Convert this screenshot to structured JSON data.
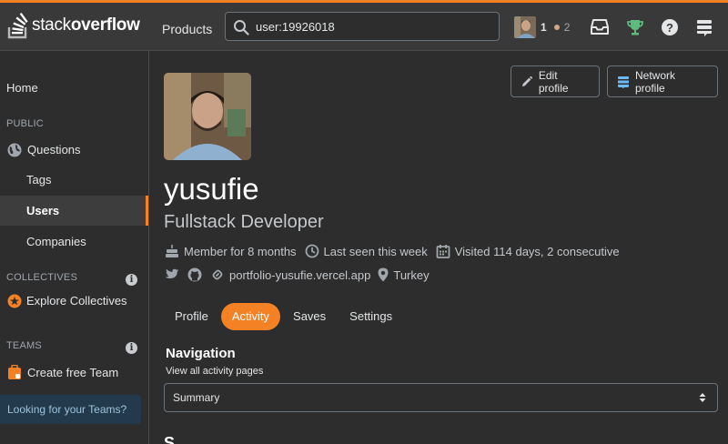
{
  "topbar": {
    "logo_light": "stack",
    "logo_bold": "overflow",
    "products_label": "Products",
    "search_value": "user:19926018",
    "reputation": "1",
    "bronze_badges": "2",
    "accent_color": "#f48225"
  },
  "sidebar": {
    "home": "Home",
    "public_heading": "PUBLIC",
    "questions": "Questions",
    "tags": "Tags",
    "users": "Users",
    "companies": "Companies",
    "collectives_heading": "COLLECTIVES",
    "explore_collectives": "Explore Collectives",
    "teams_heading": "TEAMS",
    "create_team": "Create free Team",
    "teams_callout": "Looking for your Teams?"
  },
  "profile": {
    "edit_button": "Edit profile",
    "network_button": "Network profile",
    "name": "yusufie",
    "title": "Fullstack Developer",
    "member_for": "Member for 8 months",
    "last_seen": "Last seen this week",
    "visited": "Visited 114 days, 2 consecutive",
    "website": "portfolio-yusufie.vercel.app",
    "location": "Turkey"
  },
  "tabs": [
    "Profile",
    "Activity",
    "Saves",
    "Settings"
  ],
  "active_tab": "Activity",
  "navigation": {
    "title": "Navigation",
    "subtitle": "View all activity pages",
    "selected": "Summary"
  },
  "below_fold_peek": "S"
}
